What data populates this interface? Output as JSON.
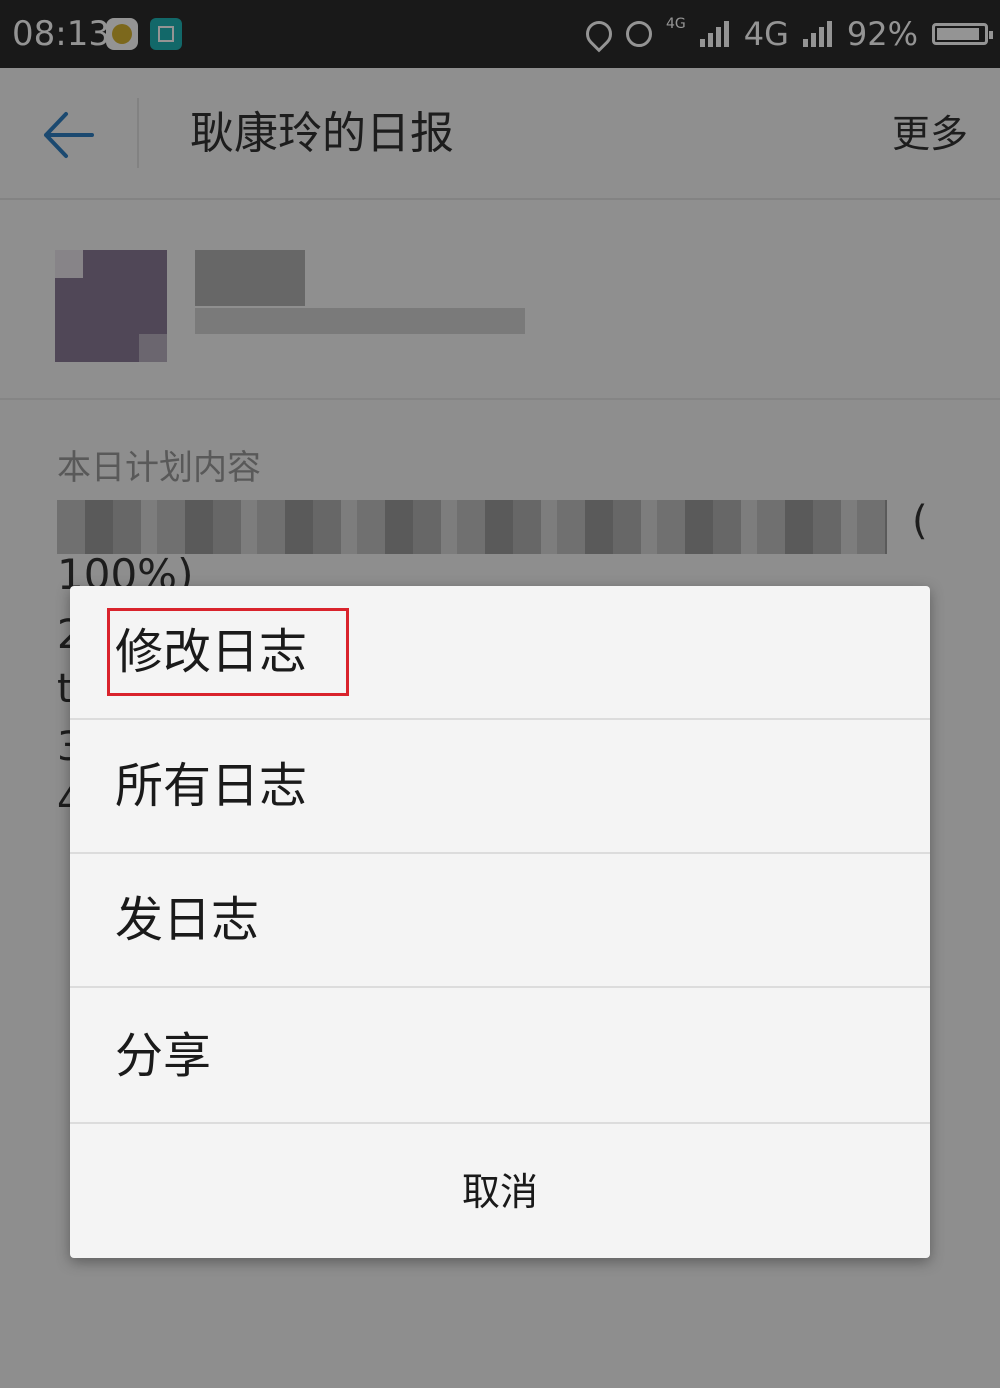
{
  "status_bar": {
    "time": "08:13",
    "network_small": "4G",
    "network": "4G",
    "battery": "92%",
    "battery_level": 0.92,
    "icons": [
      "app-notification-icon",
      "screenshot-icon",
      "location-icon",
      "alarm-icon",
      "signal-icon",
      "signal-icon",
      "battery-icon"
    ]
  },
  "header": {
    "title": "耿康玲的日报",
    "more": "更多"
  },
  "content": {
    "section_title": "本日计划内容",
    "paren": "(",
    "percent": "100%)",
    "peek_lines": [
      "2",
      "t",
      "3",
      "4"
    ]
  },
  "dialog": {
    "items": [
      {
        "label": "修改日志"
      },
      {
        "label": "所有日志"
      },
      {
        "label": "发日志"
      },
      {
        "label": "分享"
      }
    ],
    "cancel": "取消",
    "highlight_color": "#d9232c"
  }
}
